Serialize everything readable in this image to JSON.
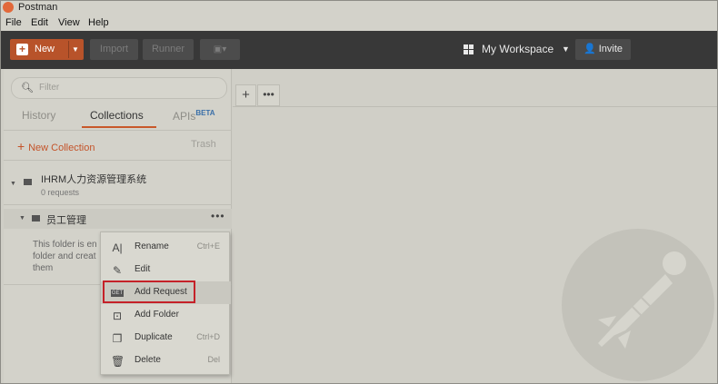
{
  "window": {
    "title": "Postman"
  },
  "menubar": {
    "file": "File",
    "edit": "Edit",
    "view": "View",
    "help": "Help"
  },
  "toolbar": {
    "new_label": "New",
    "import_label": "Import",
    "runner_label": "Runner",
    "workspace_label": "My Workspace",
    "invite_label": "Invite"
  },
  "sidebar": {
    "search_placeholder": "Filter",
    "tabs": {
      "history": "History",
      "collections": "Collections",
      "apis": "APIs",
      "apis_badge": "BETA"
    },
    "new_collection_label": "New Collection",
    "trash_label": "Trash",
    "collection": {
      "name": "IHRM人力资源管理系统",
      "count": "0 requests"
    },
    "folder": {
      "name": "员工管理",
      "empty_text": "This folder is en\nfolder and creat\nthem"
    }
  },
  "context_menu": {
    "items": [
      {
        "label": "Rename",
        "shortcut": "Ctrl+E",
        "icon": "rename-icon"
      },
      {
        "label": "Edit",
        "shortcut": "",
        "icon": "pencil-icon"
      },
      {
        "label": "Add Request",
        "shortcut": "",
        "icon": "request-icon"
      },
      {
        "label": "Add Folder",
        "shortcut": "",
        "icon": "add-folder-icon"
      },
      {
        "label": "Duplicate",
        "shortcut": "Ctrl+D",
        "icon": "duplicate-icon"
      },
      {
        "label": "Delete",
        "shortcut": "Del",
        "icon": "trash-icon"
      }
    ]
  },
  "colors": {
    "accent": "#c8582a",
    "highlight_box": "#c52128",
    "toolbar_bg": "#383838"
  }
}
